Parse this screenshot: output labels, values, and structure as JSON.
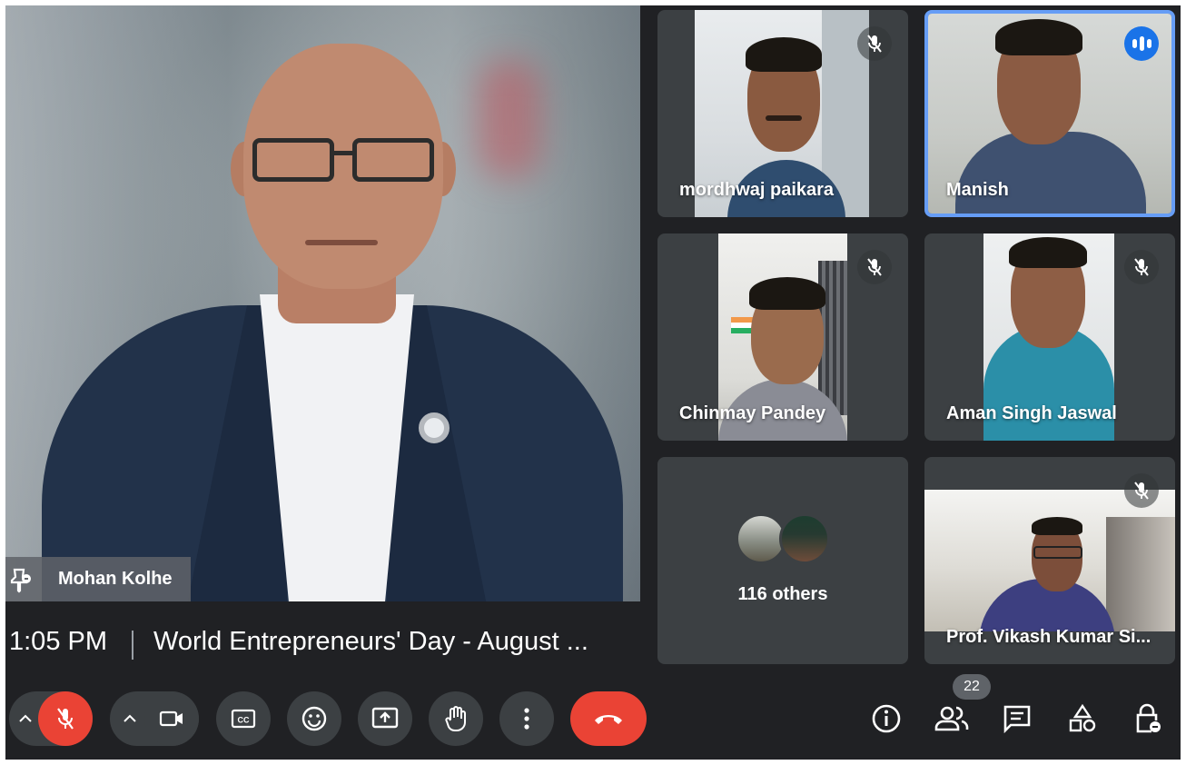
{
  "main_speaker": {
    "name": "Mohan Kolhe"
  },
  "meeting": {
    "time": "1:05 PM",
    "title": "World Entrepreneurs' Day - August ..."
  },
  "participants": [
    {
      "name": "mordhwaj paikara",
      "muted": true
    },
    {
      "name": "Manish",
      "speaking": true
    },
    {
      "name": "Chinmay Pandey",
      "muted": true
    },
    {
      "name": "Aman Singh Jaswal",
      "muted": true
    },
    {
      "name": "Prof. Vikash Kumar Si...",
      "muted": true
    }
  ],
  "others": {
    "label": "116 others"
  },
  "toolbar": {
    "items": [
      "mic-off",
      "camera",
      "captions",
      "emoji",
      "present-screen",
      "raise-hand",
      "more-options",
      "end-call"
    ]
  },
  "side_toolbar": {
    "participant_count": "22",
    "items": [
      "meeting-info",
      "people",
      "chat",
      "activities",
      "host-controls"
    ]
  },
  "colors": {
    "background": "#202124",
    "tile": "#3c4043",
    "end_call": "#ea4335",
    "active_speaker": "#1a73e8"
  }
}
